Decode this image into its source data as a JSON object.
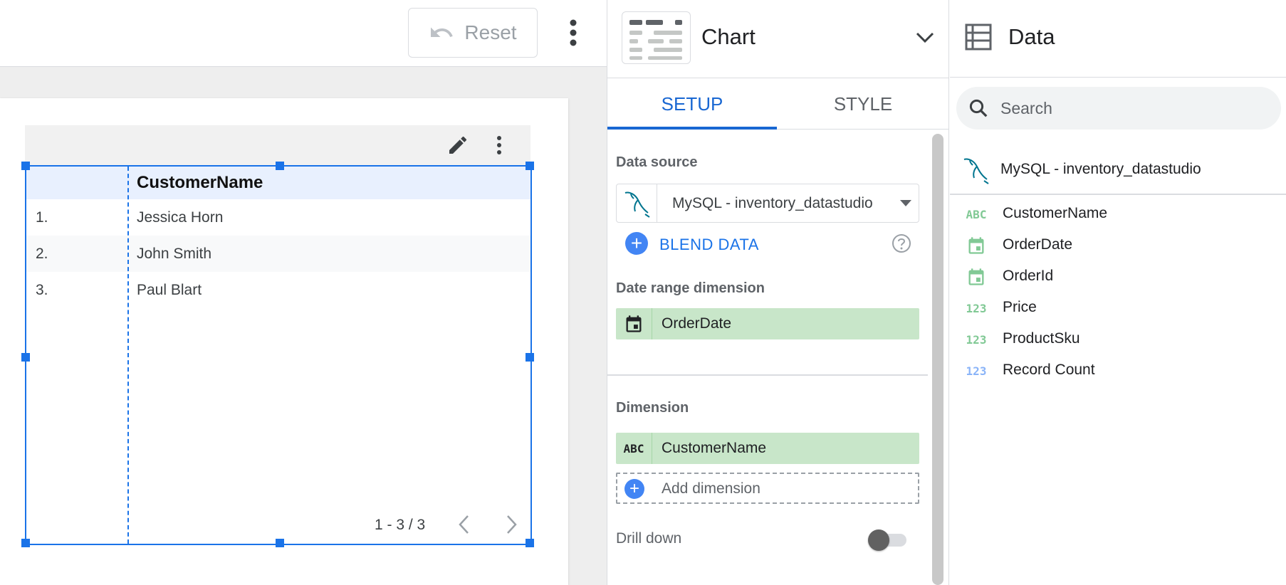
{
  "toolbar": {
    "reset_label": "Reset"
  },
  "table": {
    "header": "CustomerName",
    "rows": [
      {
        "num": "1.",
        "name": "Jessica Horn"
      },
      {
        "num": "2.",
        "name": "John Smith"
      },
      {
        "num": "3.",
        "name": "Paul Blart"
      }
    ],
    "pagination": "1 - 3 / 3"
  },
  "chart_panel": {
    "title": "Chart",
    "tabs": [
      {
        "label": "SETUP",
        "active": true
      },
      {
        "label": "STYLE",
        "active": false
      }
    ],
    "data_source_label": "Data source",
    "data_source_value": "MySQL - inventory_datastudio",
    "blend_label": "BLEND DATA",
    "date_range_label": "Date range dimension",
    "date_range_value": "OrderDate",
    "dimension_label": "Dimension",
    "dimension_value": "CustomerName",
    "dimension_type_icon": "ABC",
    "add_dimension_label": "Add dimension",
    "drill_down_label": "Drill down",
    "drill_down_enabled": false
  },
  "data_panel": {
    "title": "Data",
    "search_placeholder": "Search",
    "data_source": "MySQL - inventory_datastudio",
    "fields": [
      {
        "name": "CustomerName",
        "type_icon": "ABC",
        "icon": "text-type-icon",
        "color": "#81c995"
      },
      {
        "name": "OrderDate",
        "type_icon": "",
        "icon": "calendar-icon",
        "color": "#81c995"
      },
      {
        "name": "OrderId",
        "type_icon": "",
        "icon": "calendar-icon",
        "color": "#81c995"
      },
      {
        "name": "Price",
        "type_icon": "123",
        "icon": "number-type-icon",
        "color": "#81c995"
      },
      {
        "name": "ProductSku",
        "type_icon": "123",
        "icon": "number-type-icon",
        "color": "#81c995"
      },
      {
        "name": "Record Count",
        "type_icon": "123",
        "icon": "number-type-icon",
        "color": "#8ab4f8"
      }
    ]
  },
  "colors": {
    "accent": "#1a73e8",
    "chip_green": "#c8e6c9",
    "header_blue": "#e8f0fe"
  }
}
